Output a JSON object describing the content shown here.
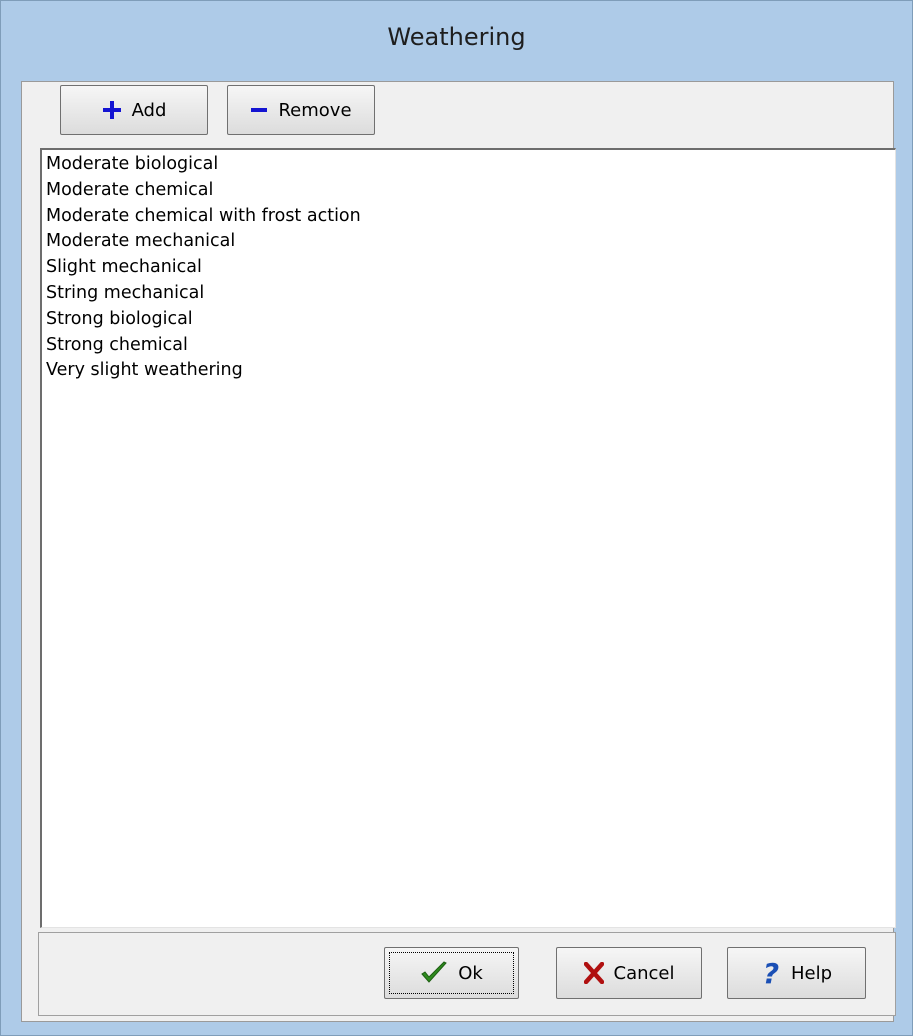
{
  "window": {
    "title": "Weathering"
  },
  "toolbar": {
    "add_label": "Add",
    "add_icon": "plus-icon",
    "remove_label": "Remove",
    "remove_icon": "minus-icon",
    "icon_color": "#1414d2"
  },
  "list": {
    "items": [
      "Moderate biological",
      "Moderate chemical",
      "Moderate chemical with frost action",
      "Moderate mechanical",
      "Slight mechanical",
      "String mechanical",
      "Strong biological",
      "Strong chemical",
      "Very slight weathering"
    ]
  },
  "footer": {
    "ok_label": "Ok",
    "ok_icon": "checkmark-icon",
    "ok_icon_color": "#2e8b1e",
    "cancel_label": "Cancel",
    "cancel_icon": "x-icon",
    "cancel_icon_color": "#b01010",
    "help_label": "Help",
    "help_icon": "question-mark-icon",
    "help_icon_color": "#1a4fb5"
  },
  "colors": {
    "frame": "#aecbe8",
    "client": "#f0f0f0",
    "list_background": "#ffffff"
  }
}
